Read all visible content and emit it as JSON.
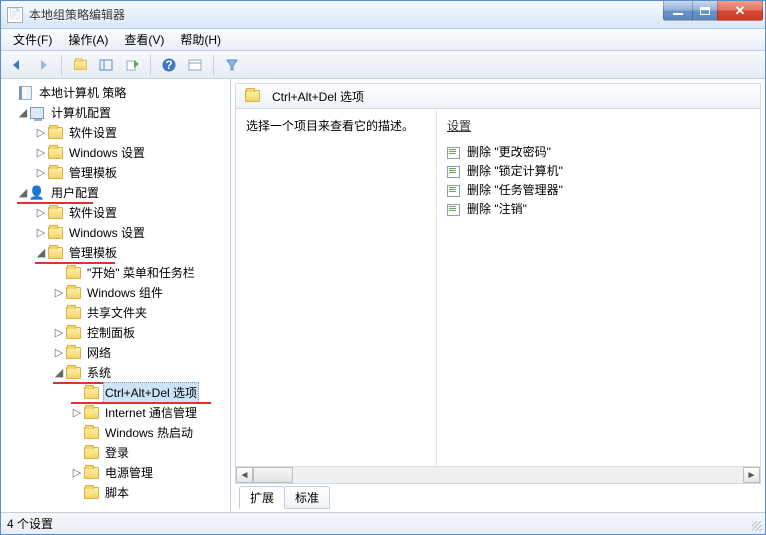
{
  "window": {
    "title": "本地组策略编辑器"
  },
  "menu": {
    "file": "文件(F)",
    "action": "操作(A)",
    "view": "查看(V)",
    "help": "帮助(H)"
  },
  "tree": {
    "root": "本地计算机 策略",
    "compCfg": "计算机配置",
    "userCfg": "用户配置",
    "soft": "软件设置",
    "winSettings": "Windows 设置",
    "adminTmpl": "管理模板",
    "startMenu": "\"开始\" 菜单和任务栏",
    "winComp": "Windows 组件",
    "shared": "共享文件夹",
    "ctrlPanel": "控制面板",
    "network": "网络",
    "system": "系统",
    "cad": "Ctrl+Alt+Del 选项",
    "inetComm": "Internet 通信管理",
    "winHot": "Windows 热启动",
    "login": "登录",
    "power": "电源管理",
    "script": "脚本"
  },
  "content": {
    "headerTitle": "Ctrl+Alt+Del 选项",
    "descPrompt": "选择一个项目来查看它的描述。",
    "settingHeader": "设置",
    "items": [
      "删除 \"更改密码\"",
      "删除 \"锁定计算机\"",
      "删除 \"任务管理器\"",
      "删除 \"注销\""
    ]
  },
  "tabs": {
    "extended": "扩展",
    "standard": "标准"
  },
  "status": "4 个设置"
}
